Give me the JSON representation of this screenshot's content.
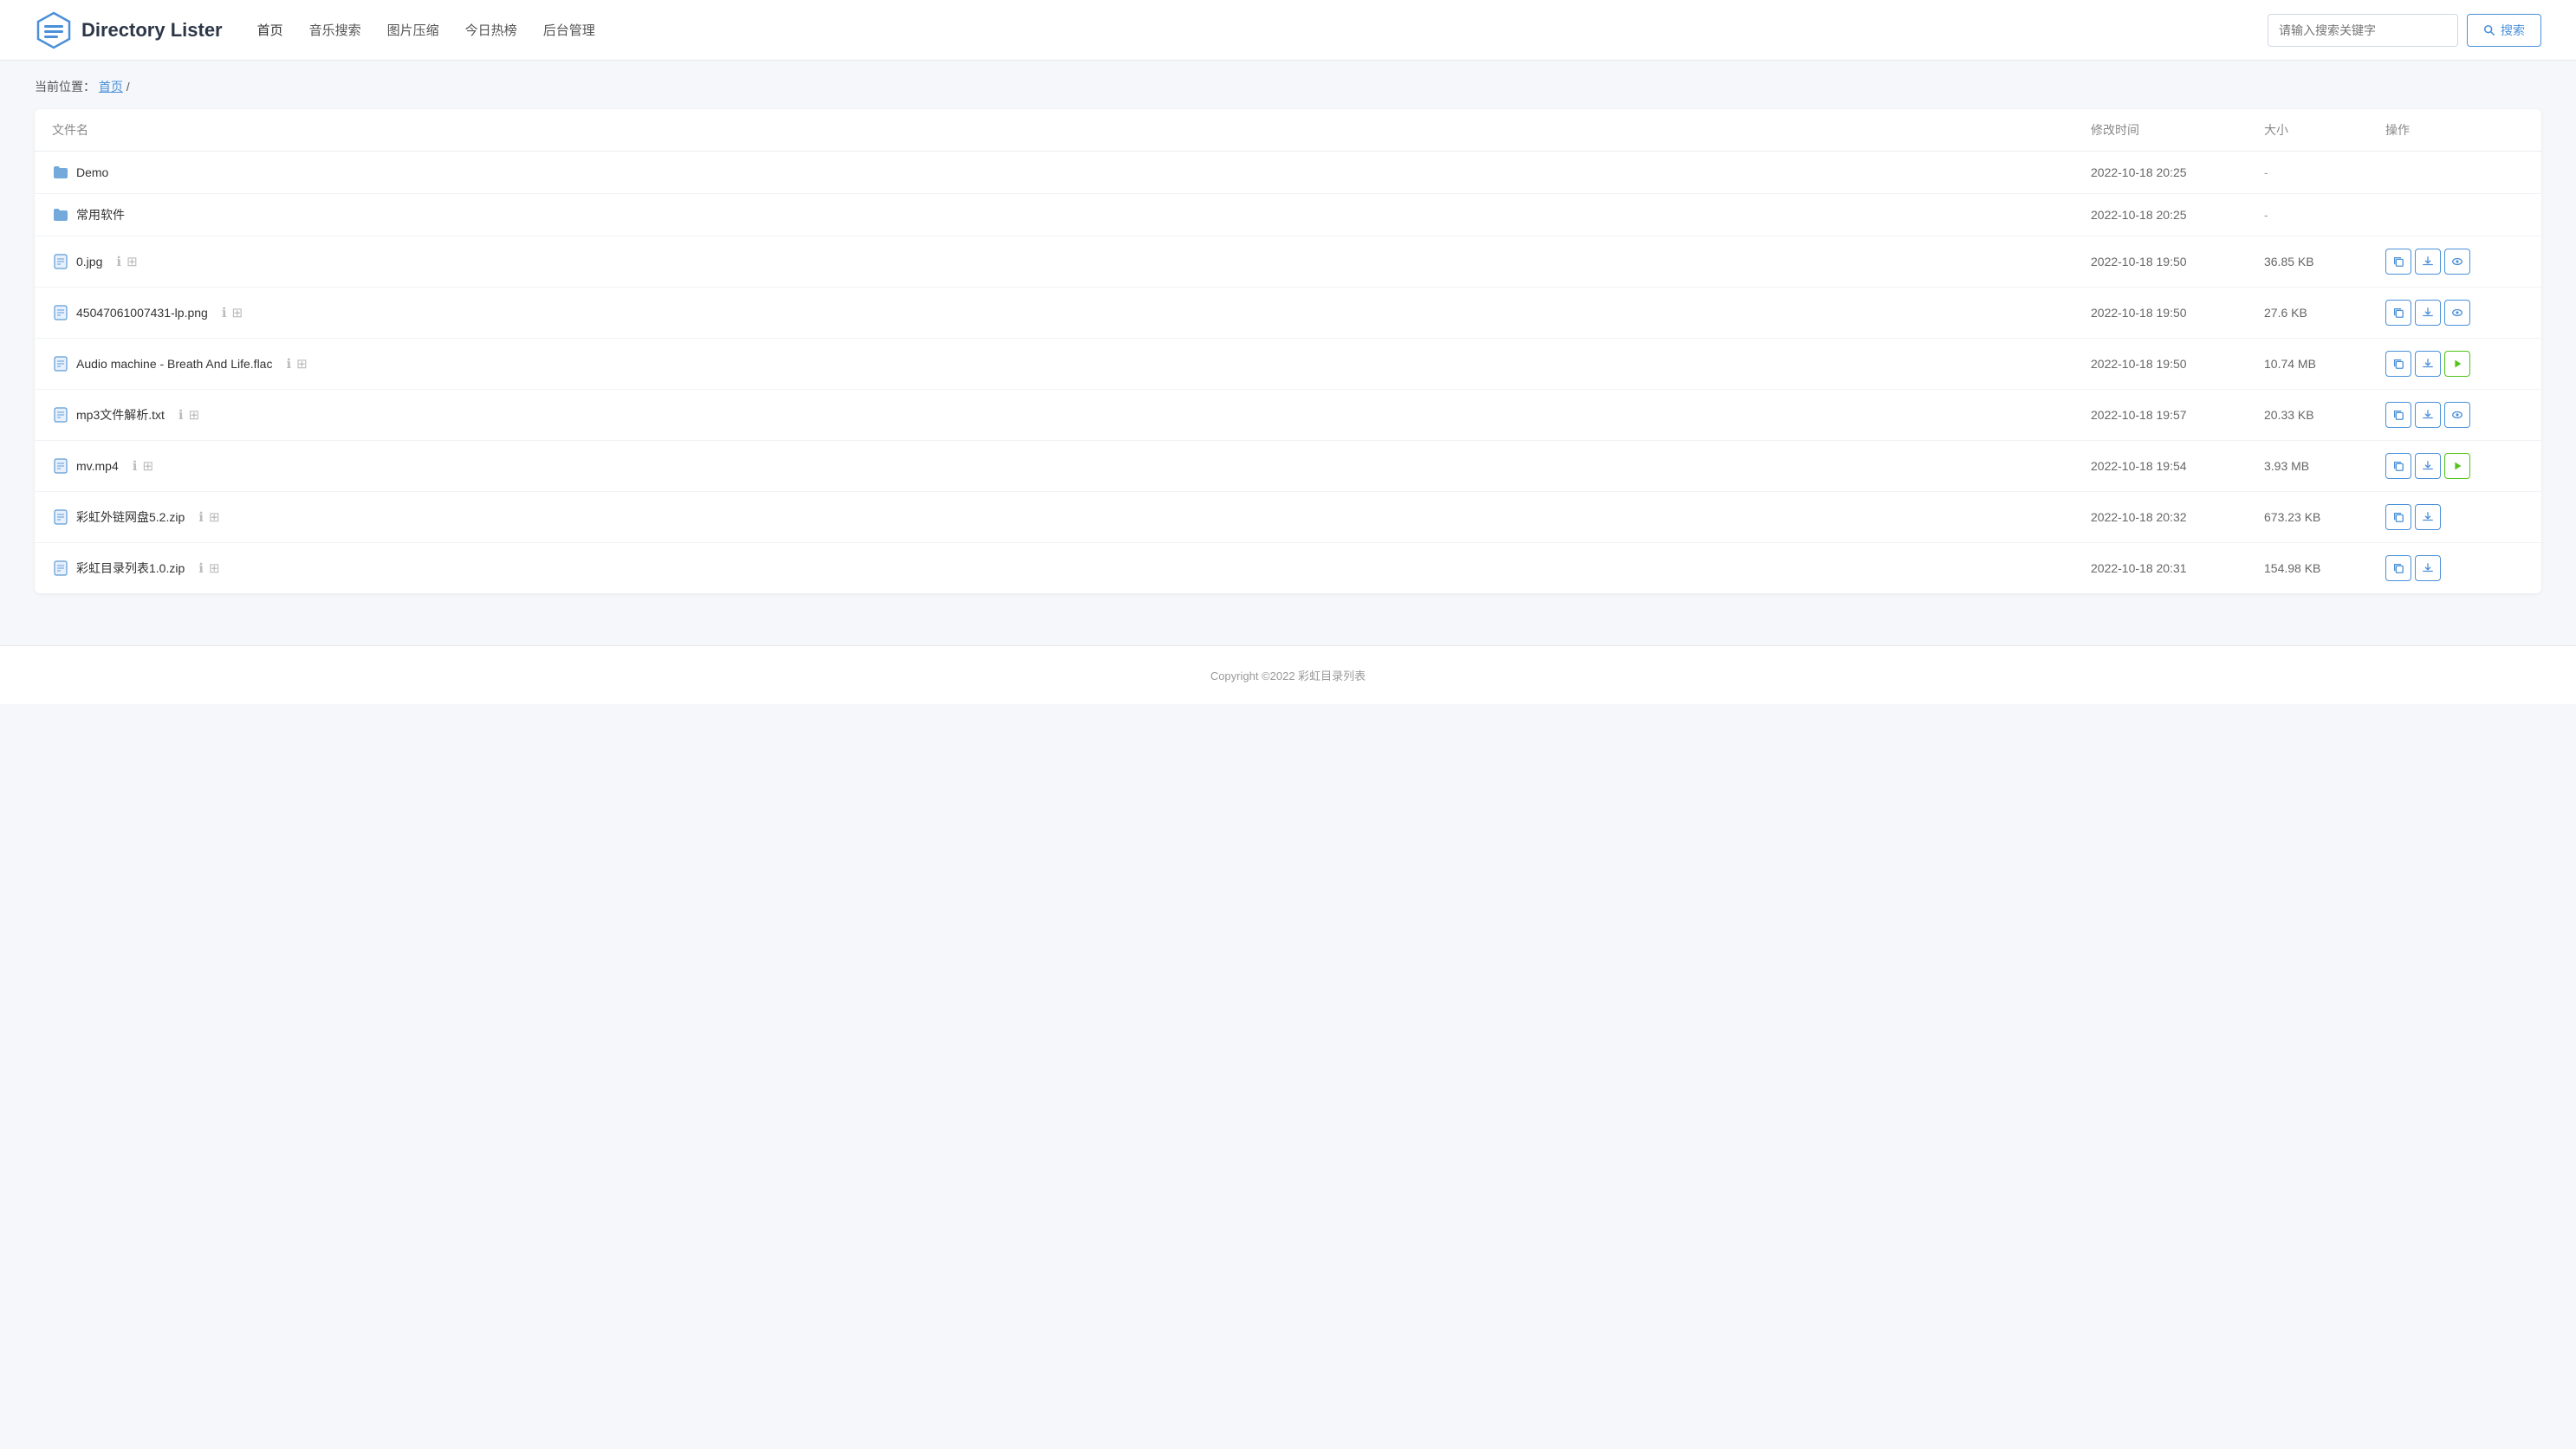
{
  "app": {
    "title": "Directory Lister"
  },
  "header": {
    "logo_text": "Directory Lister",
    "search_placeholder": "请输入搜索关键字",
    "search_button": "搜索",
    "nav_items": [
      {
        "label": "首页",
        "active": true
      },
      {
        "label": "音乐搜索",
        "active": false
      },
      {
        "label": "图片压缩",
        "active": false
      },
      {
        "label": "今日热榜",
        "active": false
      },
      {
        "label": "后台管理",
        "active": false
      }
    ]
  },
  "breadcrumb": {
    "prefix": "当前位置：",
    "home": "首页",
    "separator": "/"
  },
  "table": {
    "columns": [
      "文件名",
      "修改时间",
      "大小",
      "操作"
    ],
    "rows": [
      {
        "type": "folder",
        "name": "Demo",
        "modified": "2022-10-18 20:25",
        "size": "-",
        "actions": []
      },
      {
        "type": "folder",
        "name": "常用软件",
        "modified": "2022-10-18 20:25",
        "size": "-",
        "actions": []
      },
      {
        "type": "image",
        "name": "0.jpg",
        "modified": "2022-10-18 19:50",
        "size": "36.85 KB",
        "actions": [
          "copy",
          "download",
          "preview"
        ]
      },
      {
        "type": "image",
        "name": "45047061007431-lp.png",
        "modified": "2022-10-18 19:50",
        "size": "27.6 KB",
        "actions": [
          "copy",
          "download",
          "preview"
        ]
      },
      {
        "type": "audio",
        "name": "Audio machine - Breath And Life.flac",
        "modified": "2022-10-18 19:50",
        "size": "10.74 MB",
        "actions": [
          "copy",
          "download",
          "play"
        ]
      },
      {
        "type": "text",
        "name": "mp3文件解析.txt",
        "modified": "2022-10-18 19:57",
        "size": "20.33 KB",
        "actions": [
          "copy",
          "download",
          "preview"
        ]
      },
      {
        "type": "video",
        "name": "mv.mp4",
        "modified": "2022-10-18 19:54",
        "size": "3.93 MB",
        "actions": [
          "copy",
          "download",
          "play"
        ]
      },
      {
        "type": "zip",
        "name": "彩虹外链网盘5.2.zip",
        "modified": "2022-10-18 20:32",
        "size": "673.23 KB",
        "actions": [
          "copy",
          "download"
        ]
      },
      {
        "type": "zip",
        "name": "彩虹目录列表1.0.zip",
        "modified": "2022-10-18 20:31",
        "size": "154.98 KB",
        "actions": [
          "copy",
          "download"
        ]
      }
    ]
  },
  "footer": {
    "text": "Copyright ©2022 彩虹目录列表"
  }
}
